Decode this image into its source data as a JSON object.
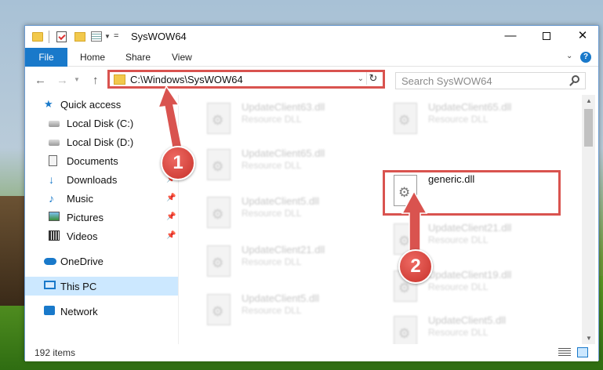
{
  "window": {
    "title": "SysWOW64",
    "controls": {
      "minimize": "—",
      "maximize": "",
      "close": "✕"
    }
  },
  "ribbon": {
    "tabs": [
      {
        "label": "File"
      },
      {
        "label": "Home"
      },
      {
        "label": "Share"
      },
      {
        "label": "View"
      }
    ],
    "help": "?",
    "collapse": "⌄"
  },
  "address": {
    "path": "C:\\Windows\\SysWOW64",
    "search_placeholder": "Search SysWOW64"
  },
  "nav_pane": {
    "items": [
      {
        "label": "Quick access",
        "icon": "star-icon"
      },
      {
        "label": "Local Disk (C:)",
        "icon": "disk-icon"
      },
      {
        "label": "Local Disk (D:)",
        "icon": "disk-icon"
      },
      {
        "label": "Documents",
        "icon": "documents-icon"
      },
      {
        "label": "Downloads",
        "icon": "download-icon",
        "pinned": true
      },
      {
        "label": "Music",
        "icon": "music-icon",
        "pinned": true
      },
      {
        "label": "Pictures",
        "icon": "pictures-icon",
        "pinned": true
      },
      {
        "label": "Videos",
        "icon": "videos-icon",
        "pinned": true
      },
      {
        "label": "OneDrive",
        "icon": "onedrive-icon"
      },
      {
        "label": "This PC",
        "icon": "pc-icon",
        "selected": true
      },
      {
        "label": "Network",
        "icon": "network-icon"
      }
    ]
  },
  "files": [
    {
      "name": "UpdateClient63.dll",
      "type": "Resource DLL"
    },
    {
      "name": "UpdateClient65.dll",
      "type": "Resource DLL"
    },
    {
      "name": "UpdateClient65.dll",
      "type": "Resource DLL"
    },
    {
      "name": "generic.dll",
      "type": ""
    },
    {
      "name": "UpdateClient5.dll",
      "type": "Resource DLL"
    },
    {
      "name": "UpdateClient21.dll",
      "type": "Resource DLL"
    },
    {
      "name": "UpdateClient21.dll",
      "type": "Resource DLL"
    },
    {
      "name": "UpdateClient19.dll",
      "type": "Resource DLL"
    },
    {
      "name": "UpdateClient5.dll",
      "type": "Resource DLL"
    },
    {
      "name": "UpdateClient5.dll",
      "type": "Resource DLL"
    }
  ],
  "status": {
    "item_count": "192 items"
  },
  "annotations": {
    "step1": "1",
    "step2": "2",
    "color": "#d9534f"
  },
  "colors": {
    "accent": "#1979ca",
    "highlight": "#d9534f",
    "selection": "#cce8ff"
  }
}
